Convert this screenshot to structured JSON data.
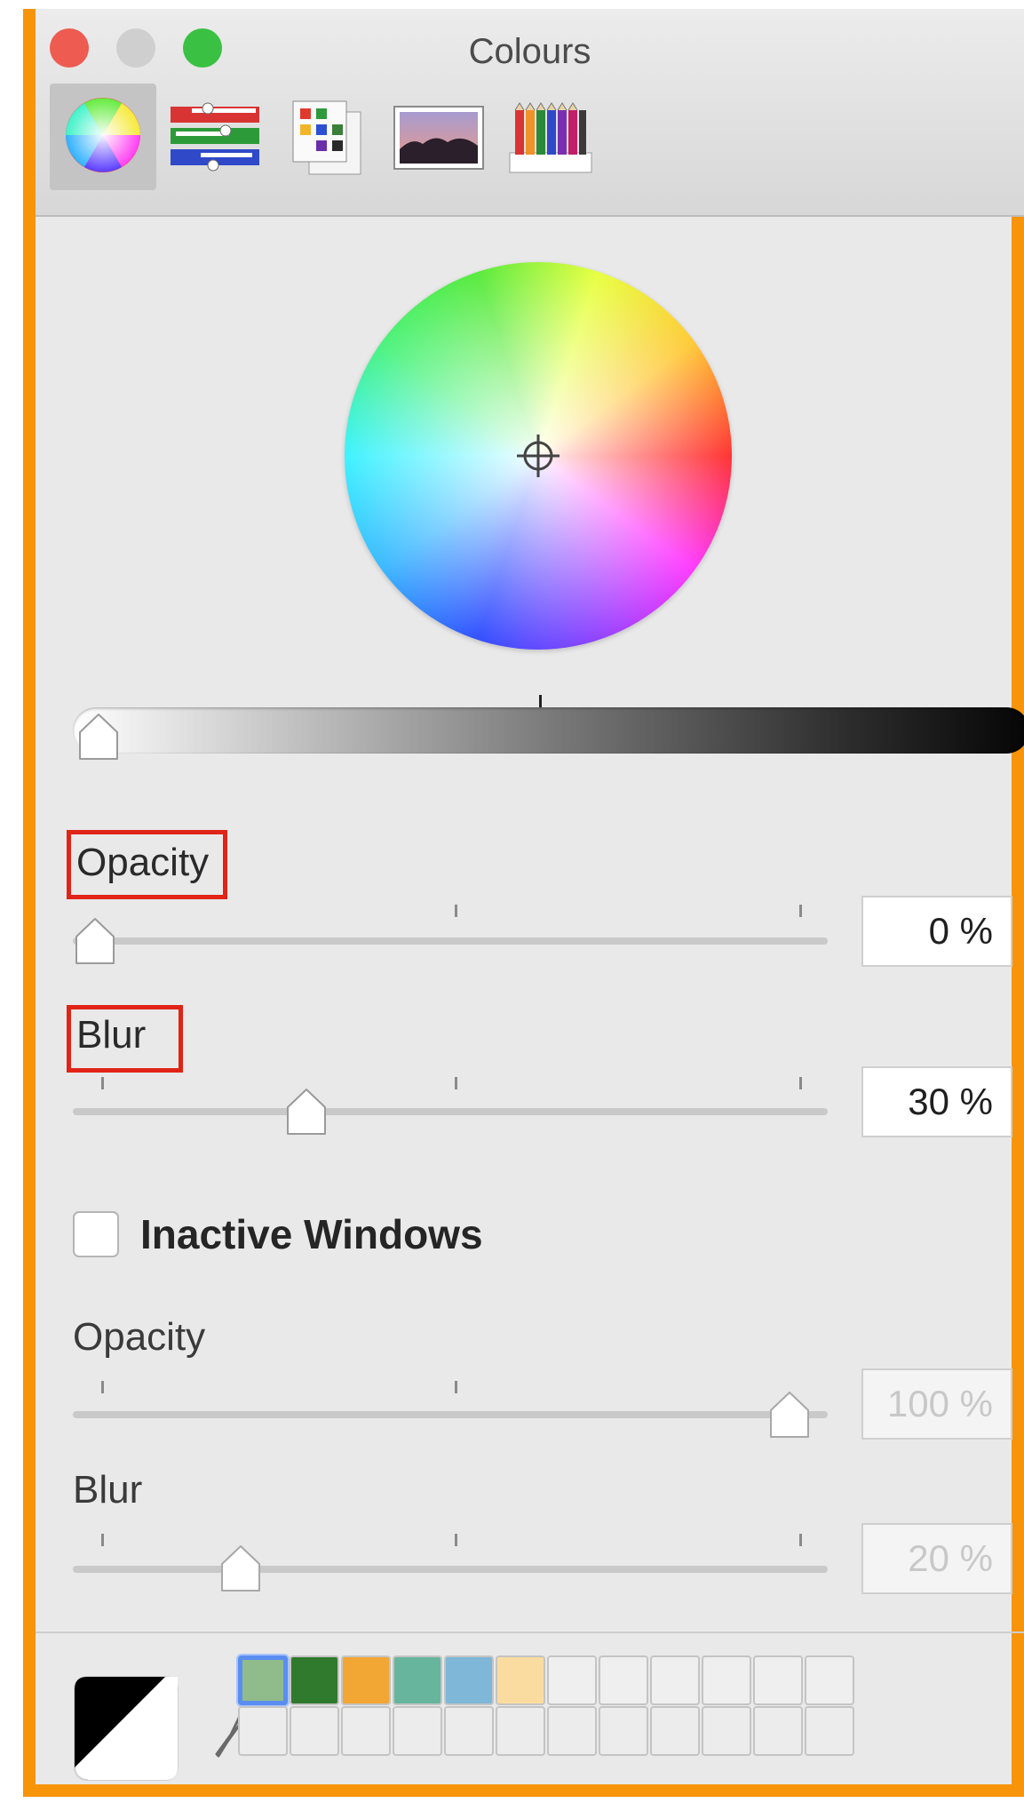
{
  "window": {
    "title": "Colours",
    "controls": [
      {
        "name": "close",
        "color": "#ee5b50"
      },
      {
        "name": "minimize",
        "color": "#cfcfcf"
      },
      {
        "name": "zoom",
        "color": "#3ac143"
      }
    ]
  },
  "toolbar": {
    "tools": [
      {
        "id": "colour-wheel",
        "selected": true
      },
      {
        "id": "colour-sliders",
        "selected": false
      },
      {
        "id": "colour-palettes",
        "selected": false
      },
      {
        "id": "image-palettes",
        "selected": false
      },
      {
        "id": "pencils",
        "selected": false
      }
    ]
  },
  "wheel": {
    "cursor": "crosshair"
  },
  "brightness": {
    "value": 0
  },
  "active": {
    "opacity_label": "Opacity",
    "opacity_value": "0 %",
    "opacity_level": 0,
    "blur_label": "Blur",
    "blur_value": "30 %",
    "blur_level": 0.3
  },
  "inactive": {
    "checkbox_label": "Inactive Windows",
    "checked": false,
    "opacity_label": "Opacity",
    "opacity_value": "100 %",
    "opacity_level": 1.0,
    "blur_label": "Blur",
    "blur_value": "20 %",
    "blur_level": 0.2
  },
  "swatches": {
    "selected_index": 0,
    "row1": [
      "#90bb8a",
      "#2f7a2c",
      "#f2a634",
      "#67b59c",
      "#7eb7d8",
      "#fbdca0",
      "#efefef",
      "#efefef",
      "#efefef",
      "#efefef",
      "#efefef",
      "#efefef"
    ],
    "row2": [
      "#ececec",
      "#ececec",
      "#ececec",
      "#ececec",
      "#ececec",
      "#ececec",
      "#ececec",
      "#ececec",
      "#ececec",
      "#ececec",
      "#ececec",
      "#ececec"
    ]
  },
  "accent": {
    "frame": "#f7940a",
    "highlight": "#e02418"
  }
}
